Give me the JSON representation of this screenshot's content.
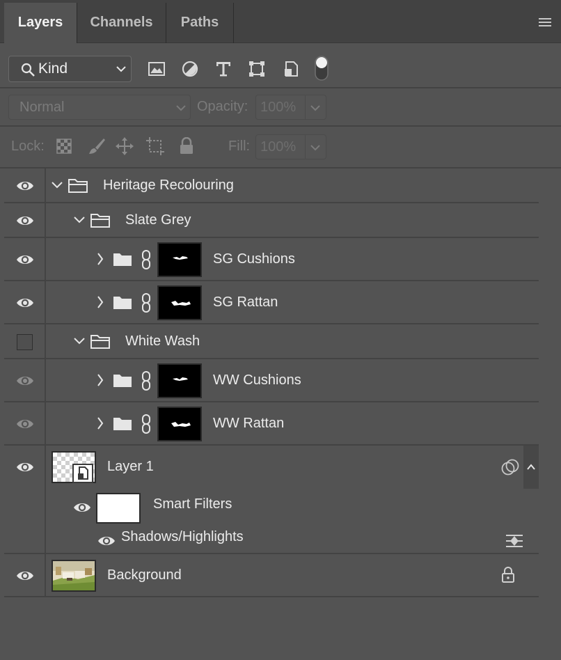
{
  "tabs": [
    {
      "label": "Layers",
      "active": true
    },
    {
      "label": "Channels",
      "active": false
    },
    {
      "label": "Paths",
      "active": false
    }
  ],
  "filter": {
    "kind_label": "Kind"
  },
  "blend": {
    "mode": "Normal",
    "opacity_label": "Opacity:",
    "opacity_value": "100%"
  },
  "lock": {
    "label": "Lock:",
    "fill_label": "Fill:",
    "fill_value": "100%"
  },
  "layers": [
    {
      "name": "Heritage Recolouring",
      "type": "group",
      "visible": true
    },
    {
      "name": "Slate Grey",
      "type": "group",
      "visible": true
    },
    {
      "name": "SG Cushions",
      "type": "group-mask",
      "visible": true
    },
    {
      "name": "SG Rattan",
      "type": "group-mask",
      "visible": true
    },
    {
      "name": "White Wash",
      "type": "group",
      "visible": false
    },
    {
      "name": "WW Cushions",
      "type": "group-mask",
      "visible": "dimmed"
    },
    {
      "name": "WW Rattan",
      "type": "group-mask",
      "visible": "dimmed"
    },
    {
      "name": "Layer 1",
      "type": "smart-object",
      "visible": true
    },
    {
      "name": "Smart Filters",
      "type": "smart-filters",
      "visible": true
    },
    {
      "name": "Shadows/Highlights",
      "type": "filter",
      "visible": true
    },
    {
      "name": "Background",
      "type": "background",
      "visible": true,
      "locked": true
    }
  ],
  "colors": {
    "panel": "#535353",
    "tabbar": "#424242",
    "divider": "#434343",
    "text": "#e6e6e6"
  }
}
